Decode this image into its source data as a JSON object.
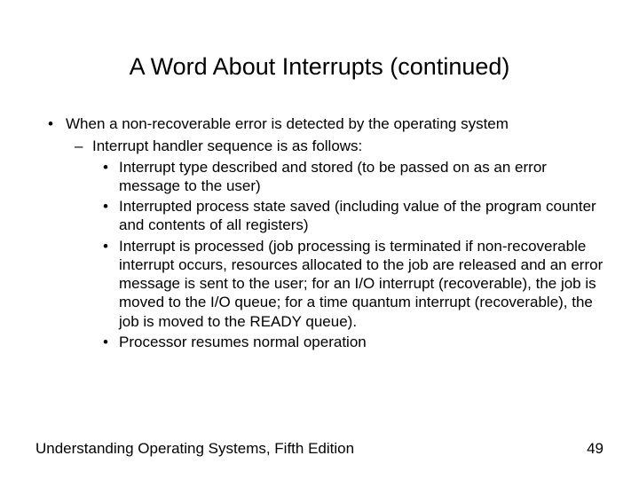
{
  "title": "A Word About Interrupts (continued)",
  "bullets": {
    "l1": "When a non-recoverable error is detected by the operating system",
    "l2": "Interrupt handler sequence is as follows:",
    "l3a": "Interrupt type described and stored (to be passed on as an error message to the user)",
    "l3b": "Interrupted process state saved (including value of the program counter and contents of all registers)",
    "l3c": "Interrupt is processed (job processing is terminated if non-recoverable interrupt occurs, resources allocated to the job are released and an error message is sent to the user; for an I/O interrupt (recoverable), the job is moved to the I/O queue; for a time quantum interrupt (recoverable), the job is moved to the READY queue).",
    "l3d": "Processor resumes normal operation"
  },
  "footer": {
    "book": "Understanding Operating Systems, Fifth Edition",
    "page": "49"
  }
}
